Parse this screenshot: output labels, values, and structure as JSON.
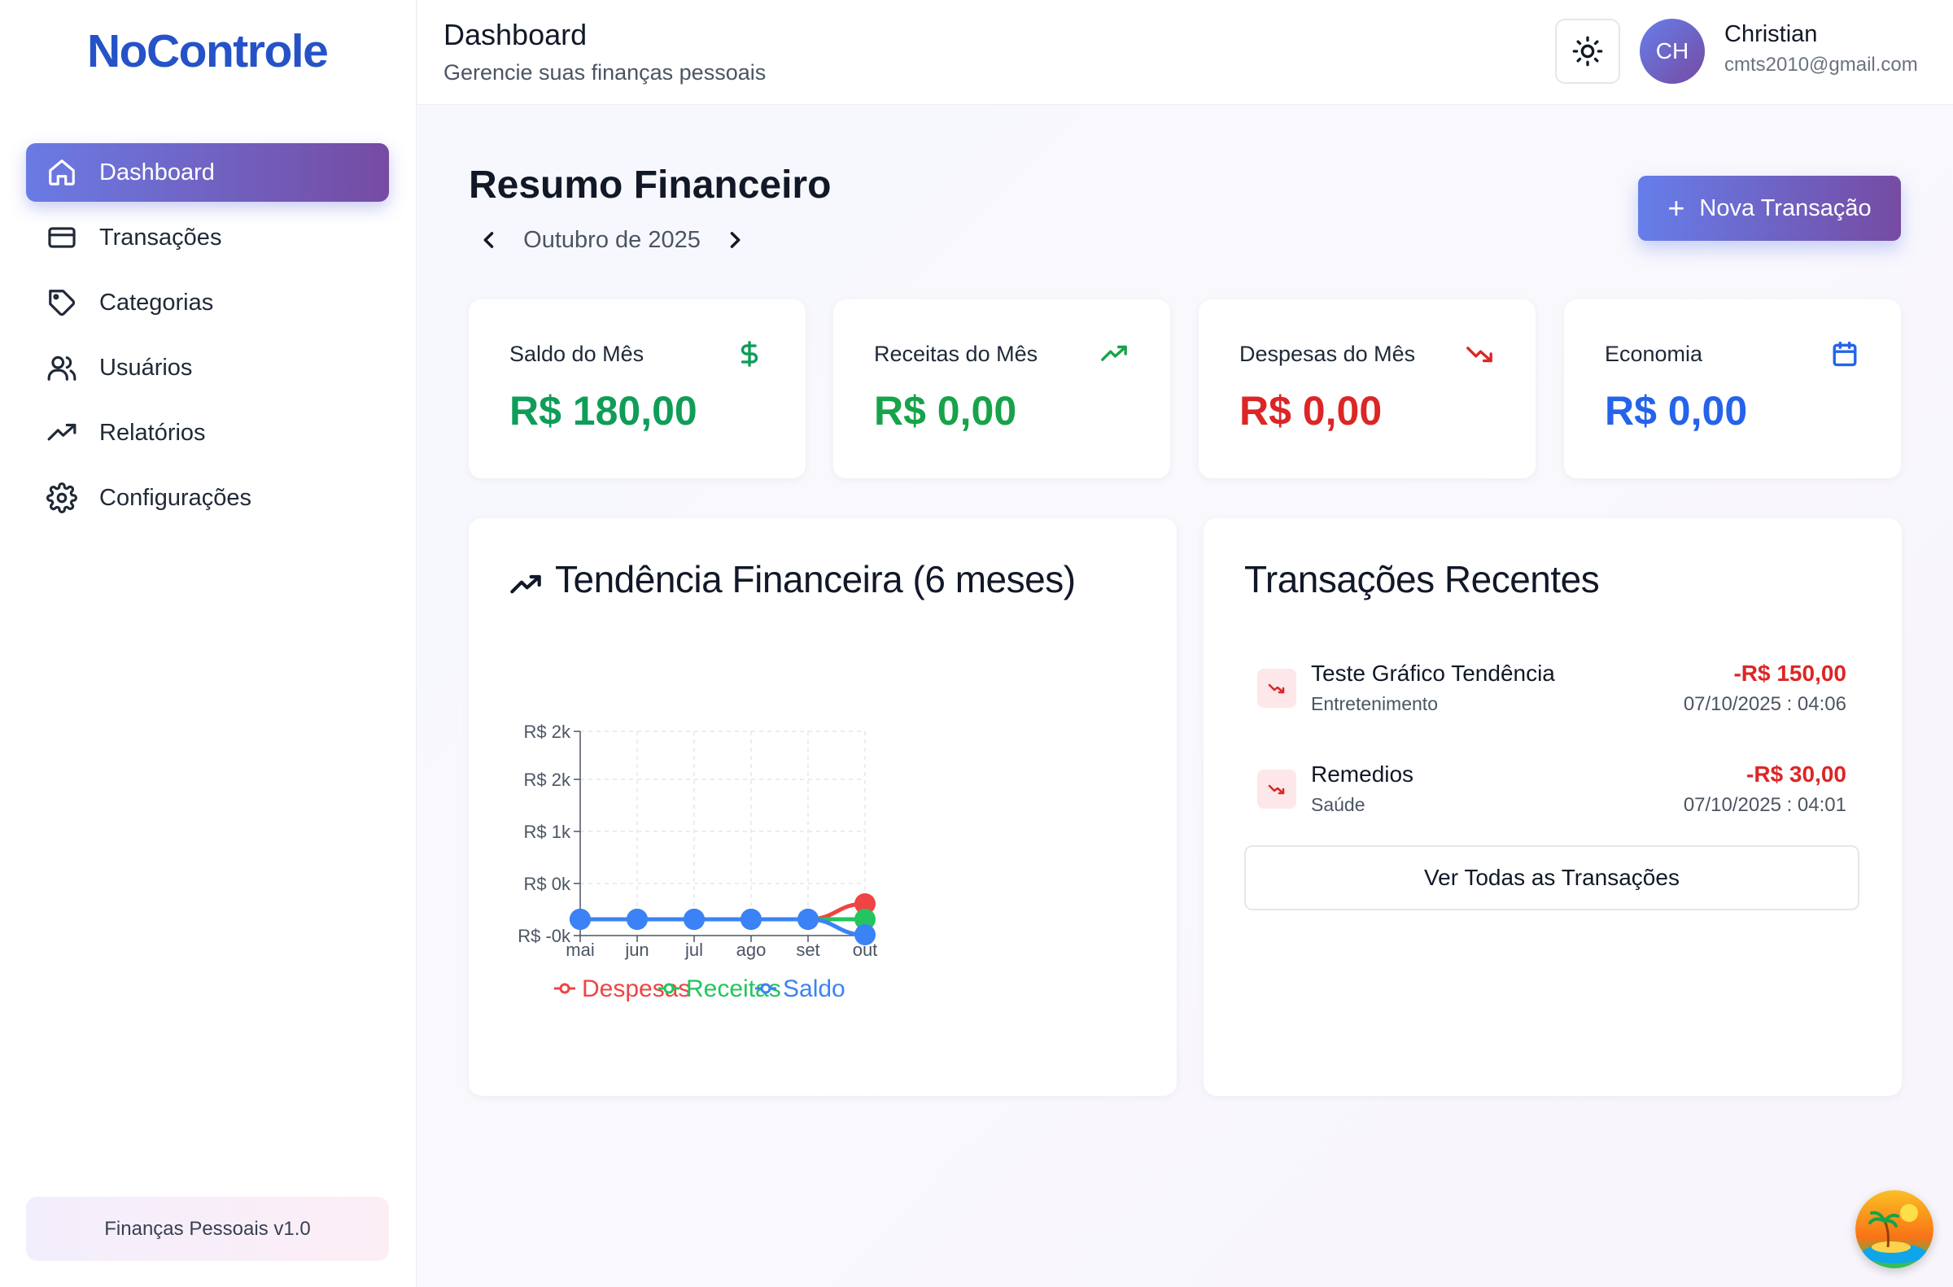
{
  "app": {
    "logo": "NoControle",
    "version": "Finanças Pessoais v1.0"
  },
  "sidebar": {
    "items": [
      {
        "label": "Dashboard",
        "icon": "home-icon",
        "active": true
      },
      {
        "label": "Transações",
        "icon": "credit-card-icon"
      },
      {
        "label": "Categorias",
        "icon": "tag-icon"
      },
      {
        "label": "Usuários",
        "icon": "users-icon"
      },
      {
        "label": "Relatórios",
        "icon": "trending-up-icon"
      },
      {
        "label": "Configurações",
        "icon": "gear-icon"
      }
    ]
  },
  "header": {
    "title": "Dashboard",
    "subtitle": "Gerencie suas finanças pessoais",
    "user": {
      "initials": "CH",
      "name": "Christian",
      "email": "cmts2010@gmail.com"
    }
  },
  "main": {
    "title": "Resumo Financeiro",
    "month": "Outubro de 2025",
    "new_transaction_label": "Nova Transação"
  },
  "stats": [
    {
      "label": "Saldo do Mês",
      "value": "R$ 180,00",
      "color": "#0f9d58",
      "icon": "dollar-icon"
    },
    {
      "label": "Receitas do Mês",
      "value": "R$ 0,00",
      "color": "#16a34a",
      "icon": "trending-up-icon"
    },
    {
      "label": "Despesas do Mês",
      "value": "R$ 0,00",
      "color": "#dc2626",
      "icon": "trending-down-icon"
    },
    {
      "label": "Economia",
      "value": "R$ 0,00",
      "color": "#2563eb",
      "icon": "calendar-icon"
    }
  ],
  "trend_card": {
    "title": "Tendência Financeira (6 meses)"
  },
  "chart_data": {
    "type": "line",
    "title": "Tendência Financeira (6 meses)",
    "categories": [
      "mai",
      "jun",
      "jul",
      "ago",
      "set",
      "out"
    ],
    "y_tick_labels": [
      "R$ 2k",
      "R$ 2k",
      "R$ 1k",
      "R$ 0k",
      "R$ -0k"
    ],
    "y_ticks": [
      2000,
      1500,
      1000,
      500,
      0
    ],
    "ylim": [
      -150,
      2000
    ],
    "grid": true,
    "legend_position": "bottom",
    "series": [
      {
        "name": "Despesas",
        "color": "#ef4444",
        "values": [
          0,
          0,
          0,
          0,
          0,
          150
        ]
      },
      {
        "name": "Receitas",
        "color": "#22c55e",
        "values": [
          0,
          0,
          0,
          0,
          0,
          0
        ]
      },
      {
        "name": "Saldo",
        "color": "#3b82f6",
        "values": [
          0,
          0,
          0,
          0,
          0,
          -150
        ]
      }
    ]
  },
  "recent": {
    "title": "Transações Recentes",
    "items": [
      {
        "name": "Teste Gráfico Tendência",
        "category": "Entretenimento",
        "amount": "-R$ 150,00",
        "date": "07/10/2025 : 04:06"
      },
      {
        "name": "Remedios",
        "category": "Saúde",
        "amount": "-R$ 30,00",
        "date": "07/10/2025 : 04:01"
      }
    ],
    "see_all_label": "Ver Todas as Transações"
  }
}
